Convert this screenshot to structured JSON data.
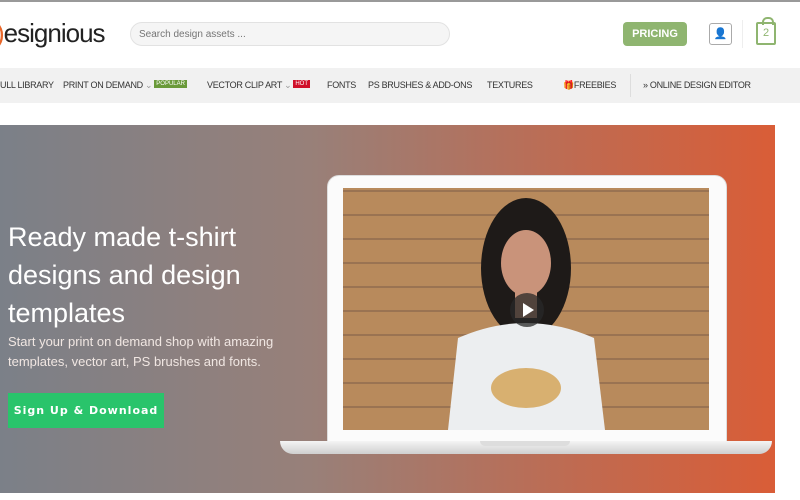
{
  "header": {
    "logo": "esignious",
    "search_placeholder": "Search design assets ...",
    "pricing": "PRICING",
    "cart_count": "2"
  },
  "nav": {
    "items": [
      "ULL LIBRARY",
      "PRINT ON DEMAND",
      "VECTOR CLIP ART",
      "FONTS",
      "PS BRUSHES & ADD-ONS",
      "TEXTURES",
      "FREEBIES",
      "ONLINE DESIGN EDITOR"
    ],
    "badges": {
      "popular": "POPULAR",
      "hot": "HOT"
    }
  },
  "hero": {
    "title": "Ready made t-shirt designs and design templates",
    "subtitle": "Start your print on demand shop with amazing templates, vector art, PS brushes and fonts.",
    "cta": "Sign Up & Download"
  },
  "colors": {
    "accent": "#8fb570",
    "cta": "#29c46b",
    "gradient_start": "#7b8088",
    "gradient_end": "#d95d37"
  }
}
